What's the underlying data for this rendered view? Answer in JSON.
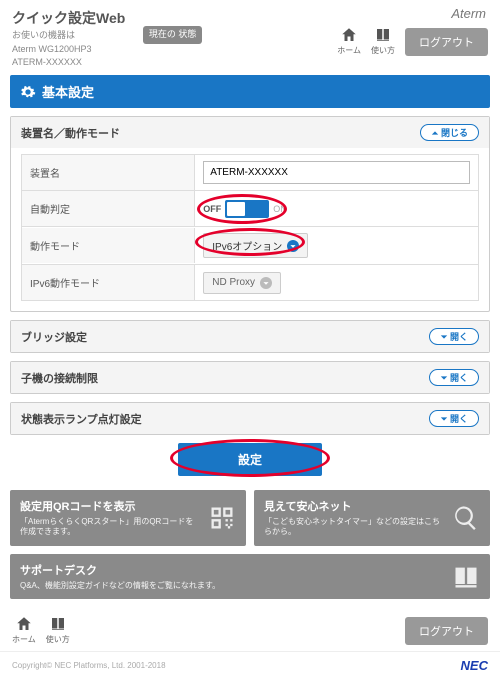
{
  "header": {
    "title": "クイック設定Web",
    "sub1": "お使いの機器は",
    "sub2": "Aterm WG1200HP3",
    "sub3": "ATERM-XXXXXX",
    "badge": "現在の\n状態",
    "brand": "Aterm",
    "home": "ホーム",
    "help": "使い方",
    "logout": "ログアウト"
  },
  "page_title": "基本設定",
  "sections": {
    "device": {
      "title": "装置名／動作モード",
      "close": "閉じる",
      "rows": {
        "name_label": "装置名",
        "name_value": "ATERM-XXXXXX",
        "auto_label": "自動判定",
        "auto_off": "OFF",
        "auto_on": "ON",
        "mode_label": "動作モード",
        "mode_value": "IPv6オプション",
        "ipv6_label": "IPv6動作モード",
        "ipv6_value": "ND Proxy"
      }
    },
    "bridge": {
      "title": "ブリッジ設定",
      "open": "開く"
    },
    "child": {
      "title": "子機の接続制限",
      "open": "開く"
    },
    "lamp": {
      "title": "状態表示ランプ点灯設定",
      "open": "開く"
    }
  },
  "submit": "設定",
  "cards": {
    "qr_title": "設定用QRコードを表示",
    "qr_desc": "「AtermらくらくQRスタート」用のQRコードを作成できます。",
    "safe_title": "見えて安心ネット",
    "safe_desc": "「こども安心ネットタイマー」などの設定はこちらから。",
    "support_title": "サポートデスク",
    "support_desc": "Q&A、機能別設定ガイドなどの情報をご覧になれます。"
  },
  "footer": {
    "home": "ホーム",
    "help": "使い方",
    "logout": "ログアウト",
    "copyright": "Copyright© NEC Platforms, Ltd. 2001-2018",
    "nec": "NEC"
  }
}
